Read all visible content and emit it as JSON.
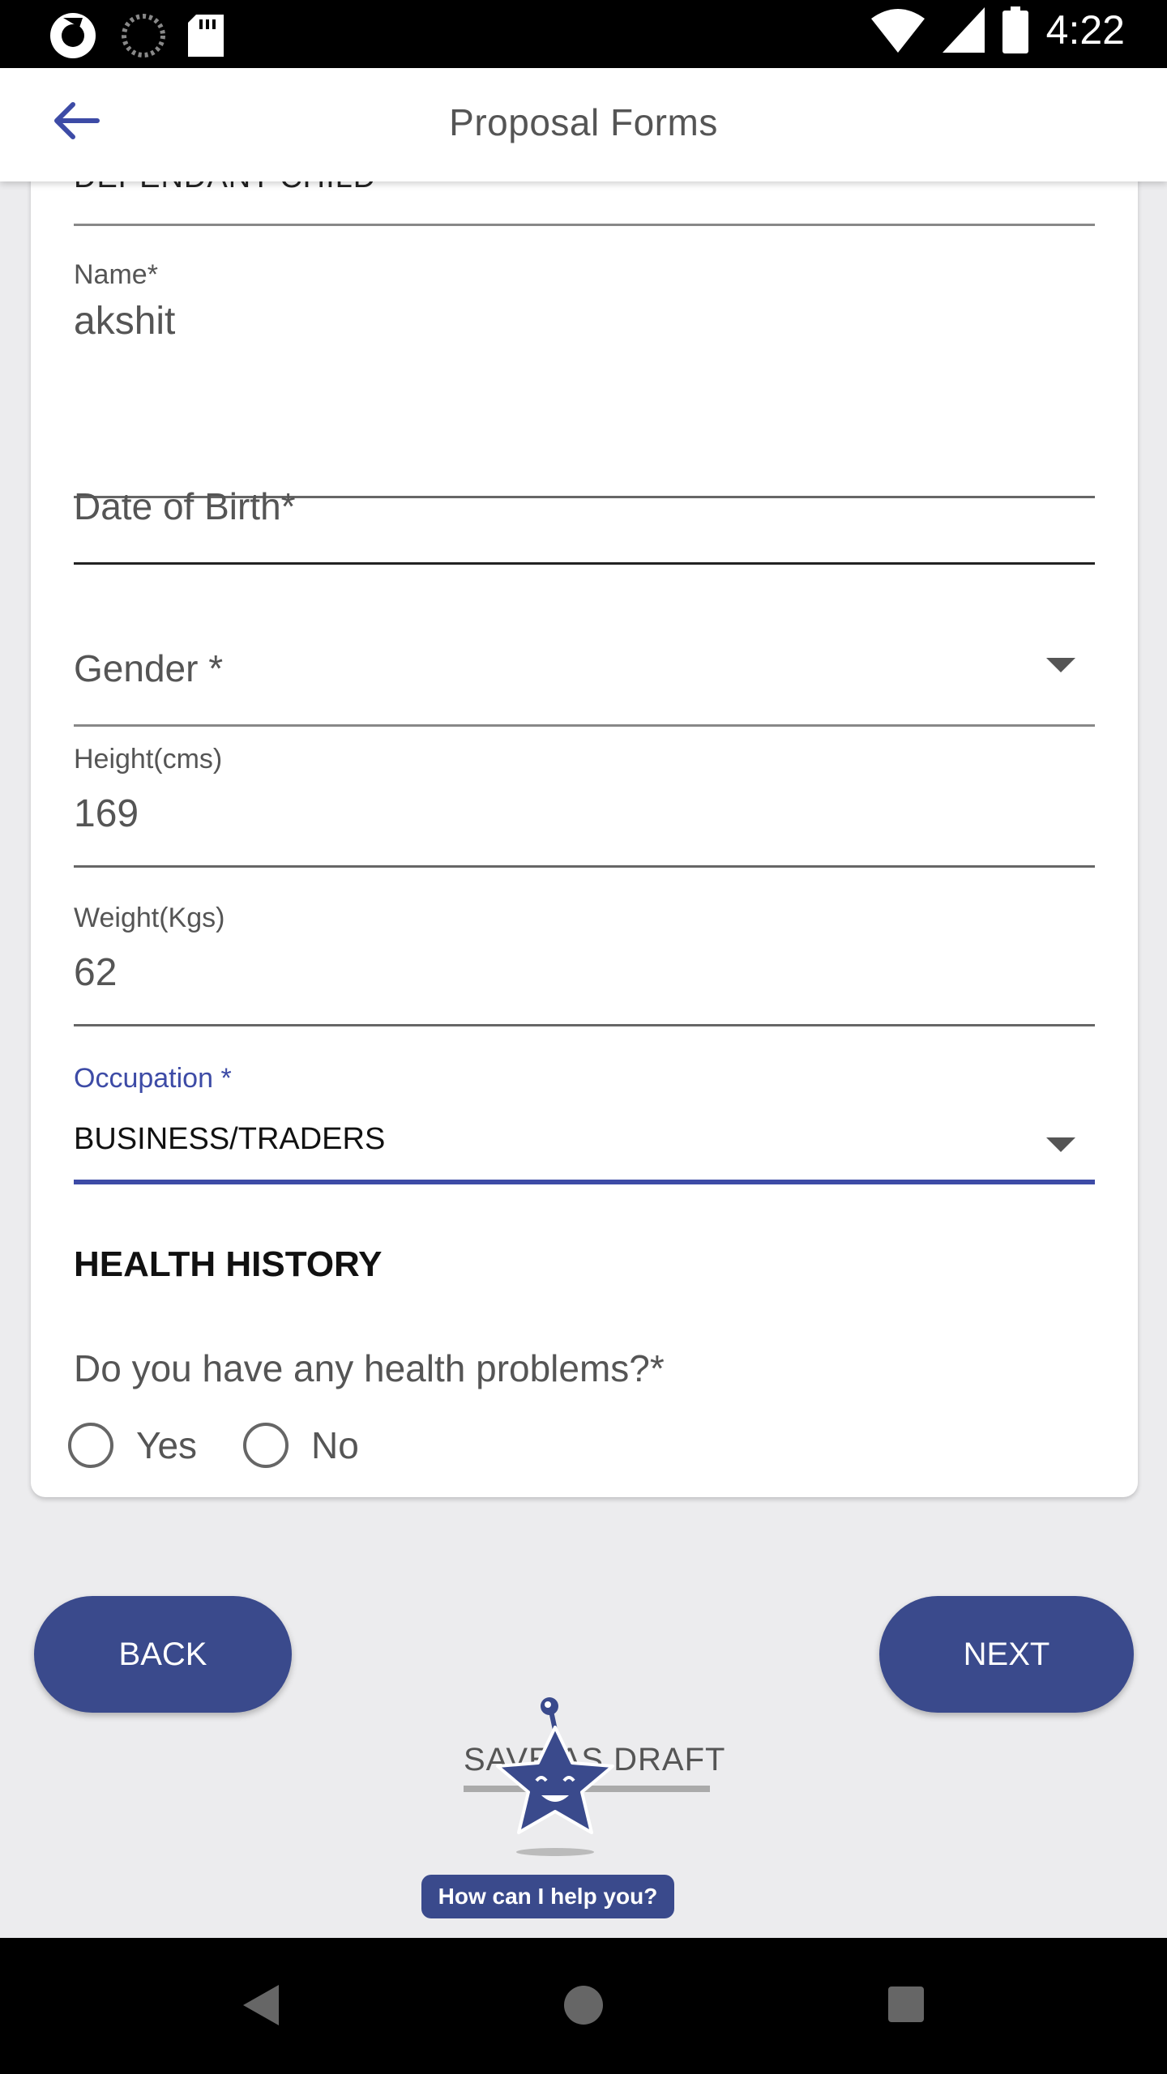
{
  "status_bar": {
    "time": "4:22",
    "left_icons": [
      "sync-icon",
      "loading-icon",
      "sd-card-icon"
    ],
    "right_icons": [
      "wifi-icon",
      "signal-icon",
      "battery-icon"
    ]
  },
  "app_bar": {
    "title": "Proposal Forms",
    "back_icon": "arrow-back-icon"
  },
  "form": {
    "relationship_value": "DEPENDANT CHILD",
    "name": {
      "label": "Name*",
      "value": "akshit"
    },
    "dob": {
      "placeholder": "Date of Birth*"
    },
    "gender": {
      "placeholder": "Gender *"
    },
    "height": {
      "label": "Height(cms)",
      "value": "169"
    },
    "weight": {
      "label": "Weight(Kgs)",
      "value": "62"
    },
    "occupation": {
      "label": "Occupation *",
      "value": "BUSINESS/TRADERS"
    }
  },
  "health": {
    "title": "HEALTH HISTORY",
    "question": "Do you have any health problems?*",
    "options": [
      "Yes",
      "No"
    ]
  },
  "buttons": {
    "back": "BACK",
    "next": "NEXT"
  },
  "draft": {
    "text": "SAVE AS DRAFT",
    "help": "How can I help you?"
  },
  "colors": {
    "accent": "#3a4a8c",
    "focus_label": "#3d4ba6",
    "background": "#ececee"
  }
}
